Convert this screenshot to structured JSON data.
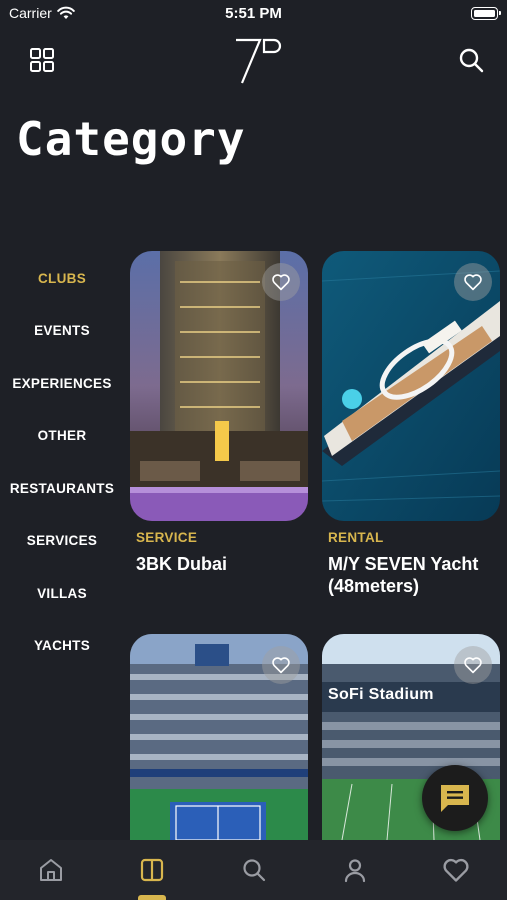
{
  "status_bar": {
    "carrier": "Carrier",
    "time": "5:51 PM"
  },
  "header": {
    "title": "Category"
  },
  "categories": [
    {
      "label": "CLUBS",
      "active": true
    },
    {
      "label": "EVENTS",
      "active": false
    },
    {
      "label": "EXPERIENCES",
      "active": false
    },
    {
      "label": "OTHER",
      "active": false
    },
    {
      "label": "RESTAURANTS",
      "active": false
    },
    {
      "label": "SERVICES",
      "active": false
    },
    {
      "label": "VILLAS",
      "active": false
    },
    {
      "label": "YACHTS",
      "active": false
    }
  ],
  "cards": [
    {
      "tag": "SERVICE",
      "title": "3BK Dubai"
    },
    {
      "tag": "RENTAL",
      "title": "M/Y SEVEN Yacht (48meters)"
    },
    {
      "tag": "",
      "title": ""
    },
    {
      "tag": "",
      "title": "",
      "sign_text": "SoFi Stadium"
    }
  ],
  "icons": {
    "grid": "grid-icon",
    "search": "search-icon",
    "favorite": "heart-icon",
    "chat": "chat-icon",
    "tabs": [
      "home-icon",
      "categories-icon",
      "search-icon",
      "profile-icon",
      "heart-icon"
    ]
  },
  "colors": {
    "background": "#1e2026",
    "accent": "#d8b64e",
    "tabbar": "#23252b"
  }
}
